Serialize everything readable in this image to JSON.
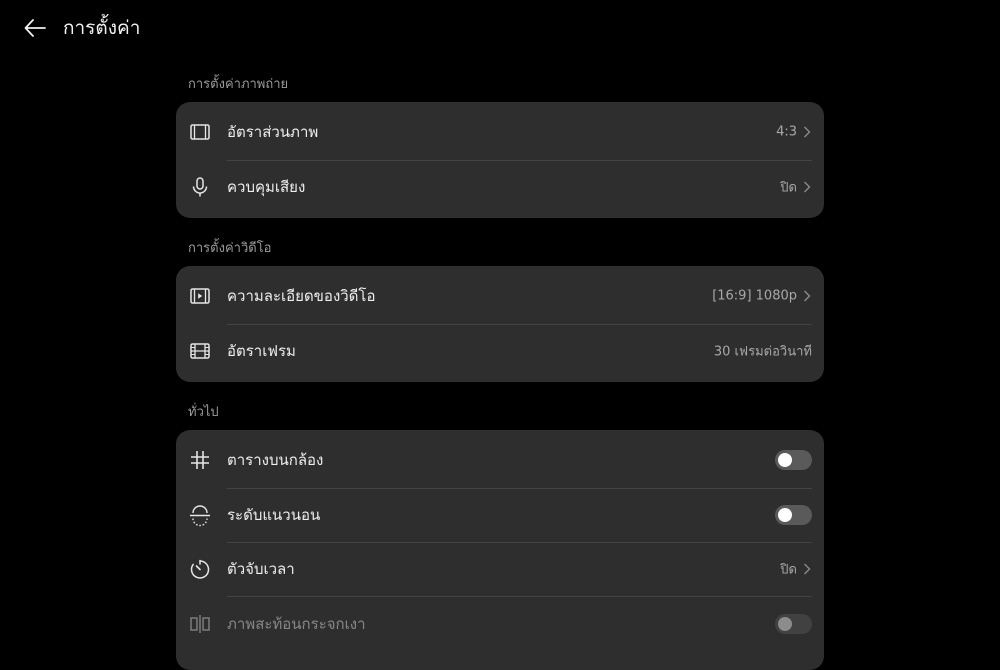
{
  "header": {
    "title": "การตั้งค่า"
  },
  "sections": {
    "photo": {
      "label": "การตั้งค่าภาพถ่าย",
      "items": [
        {
          "label": "อัตราส่วนภาพ",
          "value": "4:3"
        },
        {
          "label": "ควบคุมเสียง",
          "value": "ปิด"
        }
      ]
    },
    "video": {
      "label": "การตั้งค่าวิดีโอ",
      "items": [
        {
          "label": "ความละเอียดของวิดีโอ",
          "value": "[16:9] 1080p"
        },
        {
          "label": "อัตราเฟรม",
          "value": "30 เฟรมต่อวินาที"
        }
      ]
    },
    "general": {
      "label": "ทั่วไป",
      "items": [
        {
          "label": "ตารางบนกล้อง",
          "toggle_on": false
        },
        {
          "label": "ระดับแนวนอน",
          "toggle_on": false
        },
        {
          "label": "ตัวจับเวลา",
          "value": "ปิด"
        },
        {
          "label": "ภาพสะท้อนกระจกเงา",
          "toggle_on": false
        }
      ]
    }
  },
  "colors": {
    "background": "#000000",
    "card": "#2e2e2e",
    "toggle_off": "#5a5a5a",
    "text_secondary": "#a8a8a8"
  },
  "icons": {
    "back": "arrow-left-icon",
    "aspect_ratio": "aspect-ratio-icon",
    "audio_control": "microphone-icon",
    "video_resolution": "video-resolution-icon",
    "frame_rate": "film-frame-icon",
    "grid": "grid-icon",
    "horizontal_level": "horizontal-level-icon",
    "timer": "timer-icon",
    "mirror": "mirror-icon"
  }
}
